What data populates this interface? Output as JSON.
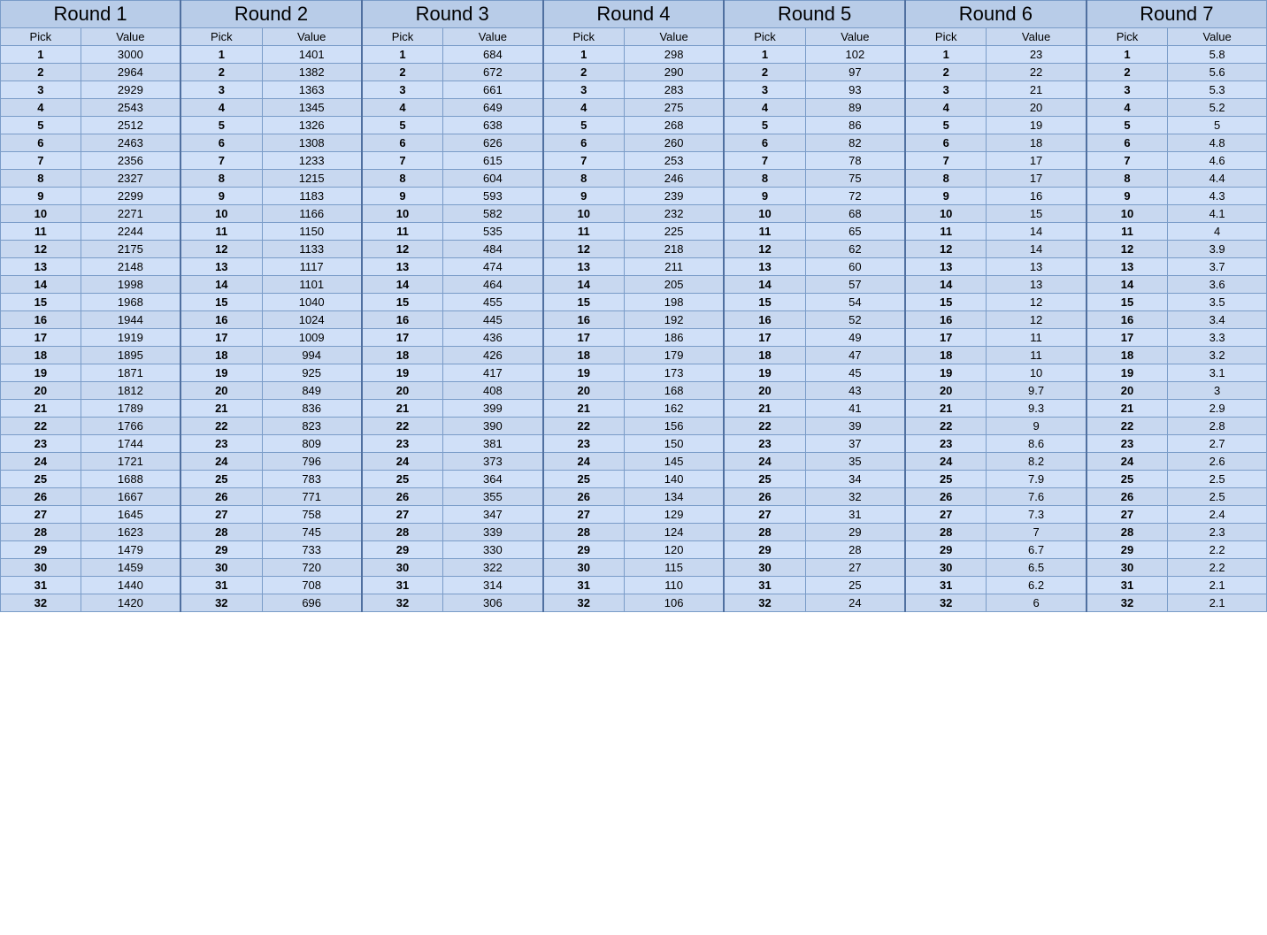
{
  "rounds": [
    {
      "label": "Round 1",
      "picks": [
        1,
        2,
        3,
        4,
        5,
        6,
        7,
        8,
        9,
        10,
        11,
        12,
        13,
        14,
        15,
        16,
        17,
        18,
        19,
        20,
        21,
        22,
        23,
        24,
        25,
        26,
        27,
        28,
        29,
        30,
        31,
        32
      ],
      "values": [
        3000,
        2964,
        2929,
        2543,
        2512,
        2463,
        2356,
        2327,
        2299,
        2271,
        2244,
        2175,
        2148,
        1998,
        1968,
        1944,
        1919,
        1895,
        1871,
        1812,
        1789,
        1766,
        1744,
        1721,
        1688,
        1667,
        1645,
        1623,
        1479,
        1459,
        1440,
        1420
      ]
    },
    {
      "label": "Round 2",
      "picks": [
        1,
        2,
        3,
        4,
        5,
        6,
        7,
        8,
        9,
        10,
        11,
        12,
        13,
        14,
        15,
        16,
        17,
        18,
        19,
        20,
        21,
        22,
        23,
        24,
        25,
        26,
        27,
        28,
        29,
        30,
        31,
        32
      ],
      "values": [
        1401,
        1382,
        1363,
        1345,
        1326,
        1308,
        1233,
        1215,
        1183,
        1166,
        1150,
        1133,
        1117,
        1101,
        1040,
        1024,
        1009,
        994,
        925,
        849,
        836,
        823,
        809,
        796,
        783,
        771,
        758,
        745,
        733,
        720,
        708,
        696
      ]
    },
    {
      "label": "Round 3",
      "picks": [
        1,
        2,
        3,
        4,
        5,
        6,
        7,
        8,
        9,
        10,
        11,
        12,
        13,
        14,
        15,
        16,
        17,
        18,
        19,
        20,
        21,
        22,
        23,
        24,
        25,
        26,
        27,
        28,
        29,
        30,
        31,
        32
      ],
      "values": [
        684,
        672,
        661,
        649,
        638,
        626,
        615,
        604,
        593,
        582,
        535,
        484,
        474,
        464,
        455,
        445,
        436,
        426,
        417,
        408,
        399,
        390,
        381,
        373,
        364,
        355,
        347,
        339,
        330,
        322,
        314,
        306
      ]
    },
    {
      "label": "Round 4",
      "picks": [
        1,
        2,
        3,
        4,
        5,
        6,
        7,
        8,
        9,
        10,
        11,
        12,
        13,
        14,
        15,
        16,
        17,
        18,
        19,
        20,
        21,
        22,
        23,
        24,
        25,
        26,
        27,
        28,
        29,
        30,
        31,
        32
      ],
      "values": [
        298,
        290,
        283,
        275,
        268,
        260,
        253,
        246,
        239,
        232,
        225,
        218,
        211,
        205,
        198,
        192,
        186,
        179,
        173,
        168,
        162,
        156,
        150,
        145,
        140,
        134,
        129,
        124,
        120,
        115,
        110,
        106
      ]
    },
    {
      "label": "Round 5",
      "picks": [
        1,
        2,
        3,
        4,
        5,
        6,
        7,
        8,
        9,
        10,
        11,
        12,
        13,
        14,
        15,
        16,
        17,
        18,
        19,
        20,
        21,
        22,
        23,
        24,
        25,
        26,
        27,
        28,
        29,
        30,
        31,
        32
      ],
      "values": [
        102,
        97,
        93,
        89,
        86,
        82,
        78,
        75,
        72,
        68,
        65,
        62,
        60,
        57,
        54,
        52,
        49,
        47,
        45,
        43,
        41,
        39,
        37,
        35,
        34,
        32,
        31,
        29,
        28,
        27,
        25,
        24
      ]
    },
    {
      "label": "Round 6",
      "picks": [
        1,
        2,
        3,
        4,
        5,
        6,
        7,
        8,
        9,
        10,
        11,
        12,
        13,
        14,
        15,
        16,
        17,
        18,
        19,
        20,
        21,
        22,
        23,
        24,
        25,
        26,
        27,
        28,
        29,
        30,
        31,
        32
      ],
      "values": [
        23,
        22,
        21,
        20,
        19,
        18,
        17,
        17,
        16,
        15,
        14,
        14,
        13,
        13,
        12,
        12,
        11,
        11,
        10,
        9.7,
        9.3,
        9,
        8.6,
        8.2,
        7.9,
        7.6,
        7.3,
        7,
        6.7,
        6.5,
        6.2,
        6
      ]
    },
    {
      "label": "Round 7",
      "picks": [
        1,
        2,
        3,
        4,
        5,
        6,
        7,
        8,
        9,
        10,
        11,
        12,
        13,
        14,
        15,
        16,
        17,
        18,
        19,
        20,
        21,
        22,
        23,
        24,
        25,
        26,
        27,
        28,
        29,
        30,
        31,
        32
      ],
      "values": [
        5.8,
        5.6,
        5.3,
        5.2,
        5,
        4.8,
        4.6,
        4.4,
        4.3,
        4.1,
        4,
        3.9,
        3.7,
        3.6,
        3.5,
        3.4,
        3.3,
        3.2,
        3.1,
        3,
        2.9,
        2.8,
        2.7,
        2.6,
        2.5,
        2.5,
        2.4,
        2.3,
        2.2,
        2.2,
        2.1,
        2.1
      ]
    }
  ],
  "col_headers": {
    "pick": "Pick",
    "value": "Value"
  }
}
